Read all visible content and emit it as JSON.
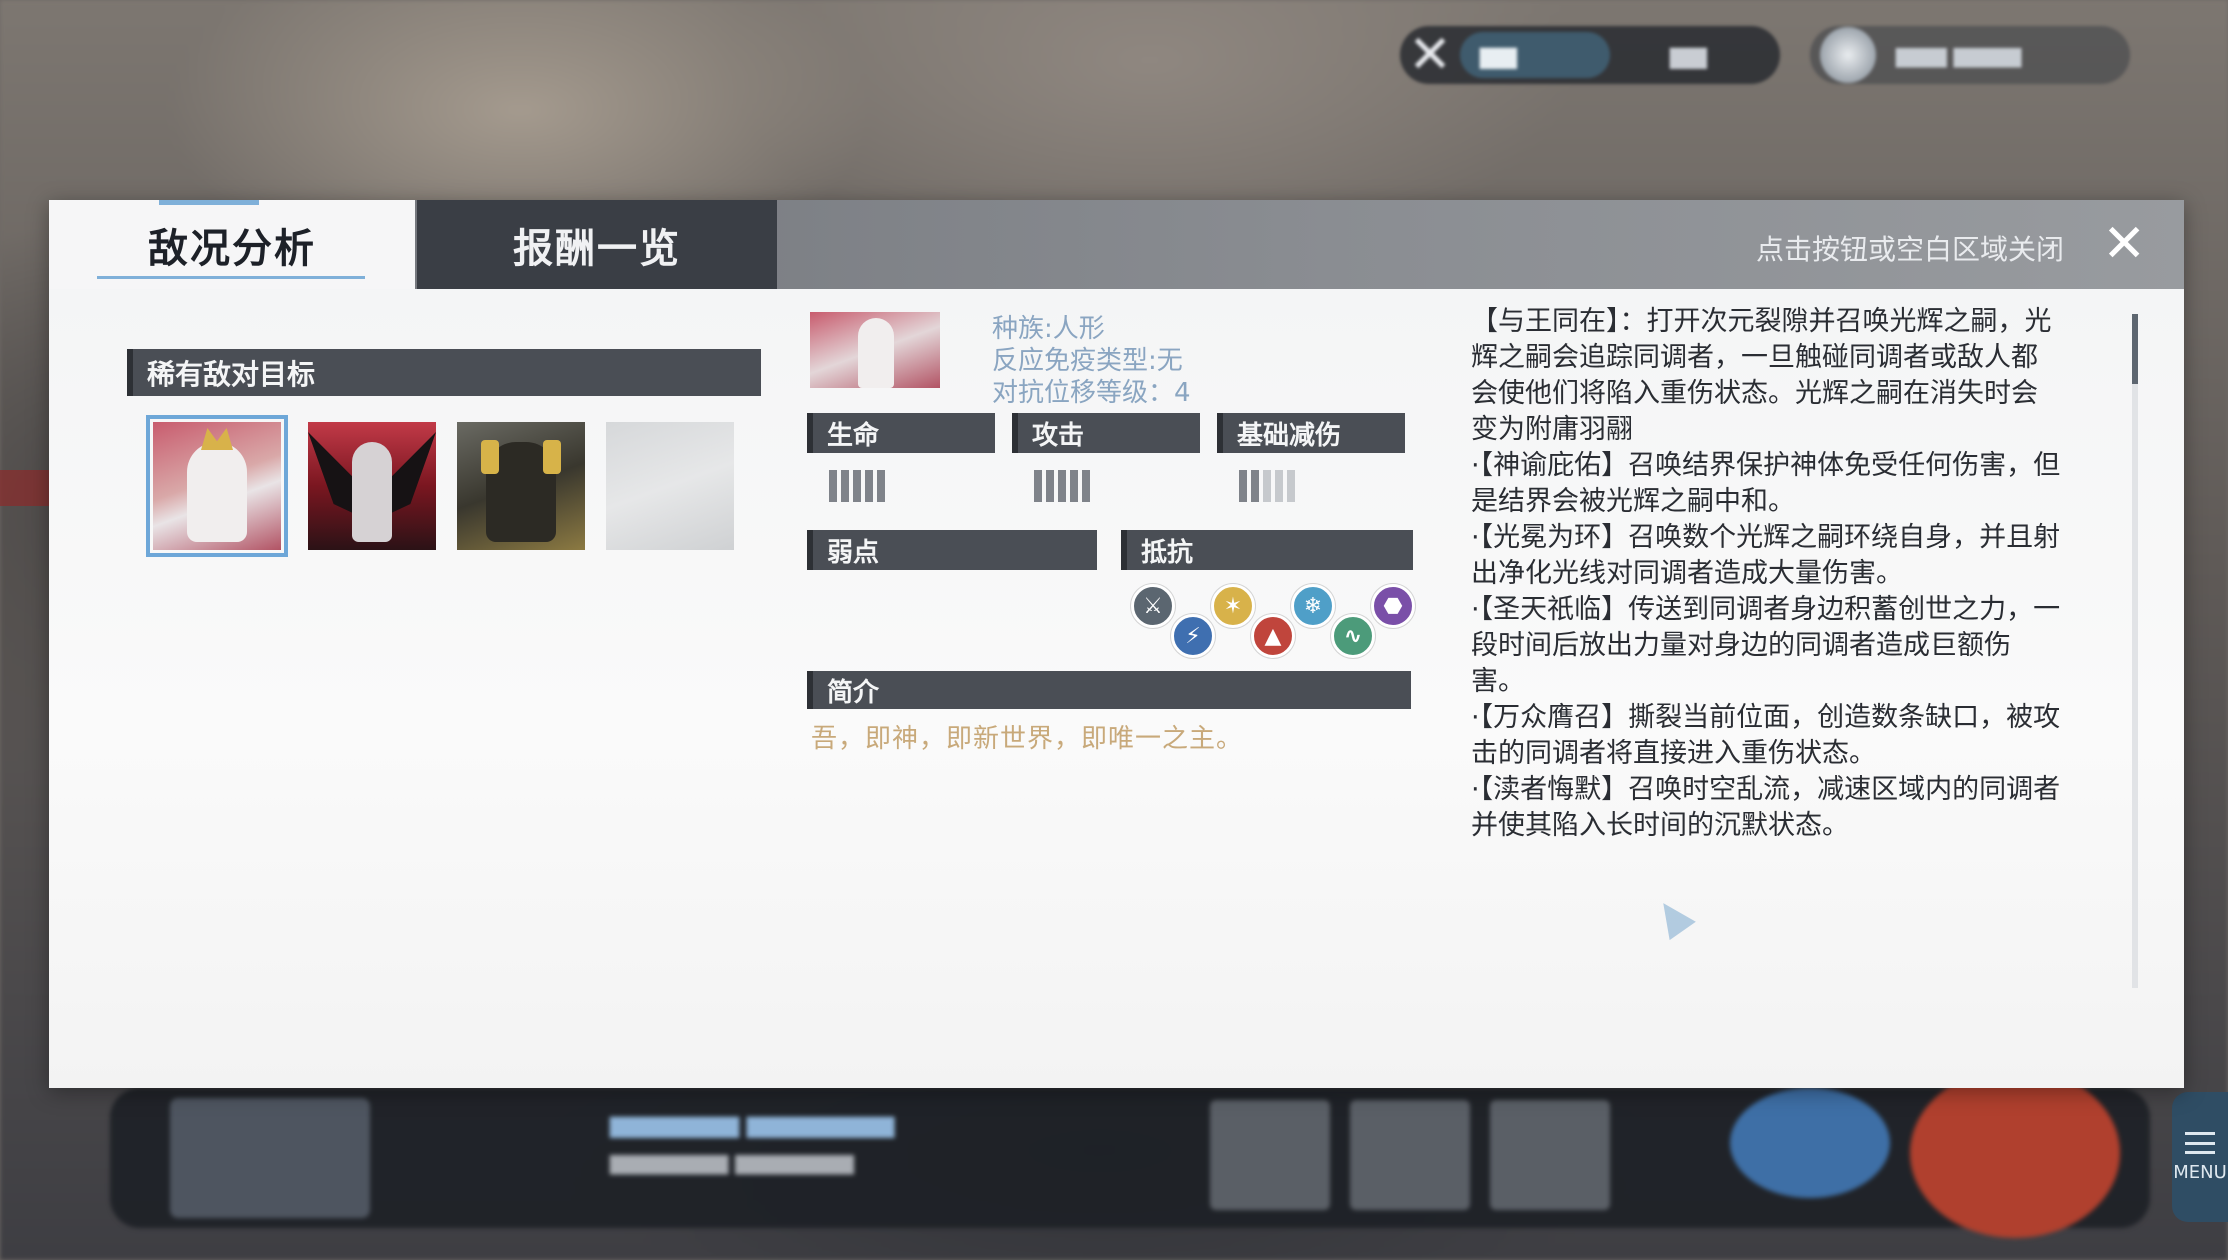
{
  "tabs": [
    {
      "label": "敌况分析",
      "active": true
    },
    {
      "label": "报酬一览",
      "active": false
    }
  ],
  "close_hint": "点击按钮或空白区域关闭",
  "close_icon": "close-icon",
  "rare_targets": {
    "title": "稀有敌对目标",
    "portraits": [
      "enemy-portrait-1",
      "enemy-portrait-2",
      "enemy-portrait-3",
      "enemy-portrait-4"
    ],
    "selected_index": 0
  },
  "enemy_info": {
    "race": "种族:人形",
    "immunity": "反应免疫类型:无",
    "level": "对抗位移等级：4"
  },
  "stats": {
    "hp": {
      "label": "生命",
      "level": 5,
      "max": 5
    },
    "atk": {
      "label": "攻击",
      "level": 5,
      "max": 5
    },
    "def": {
      "label": "基础减伤",
      "level": 2,
      "max": 5
    }
  },
  "weakness": {
    "label": "弱点"
  },
  "resistance": {
    "label": "抵抗",
    "icons": [
      {
        "name": "physical-resist-icon",
        "color": "#5b6670"
      },
      {
        "name": "electric-resist-icon",
        "color": "#3f6fb0"
      },
      {
        "name": "light-resist-icon",
        "color": "#d8b24a"
      },
      {
        "name": "fire-resist-icon",
        "color": "#c0453c"
      },
      {
        "name": "ice-resist-icon",
        "color": "#4f9fc8"
      },
      {
        "name": "wind-resist-icon",
        "color": "#4c9b7a"
      },
      {
        "name": "dark-resist-icon",
        "color": "#7a4fa8"
      }
    ]
  },
  "intro": {
    "label": "简介",
    "text": "吾，即神，即新世界，即唯一之主。"
  },
  "description": [
    "【与王同在】：打开次元裂隙并召唤光辉之嗣，光辉之嗣会追踪同调者，一旦触碰同调者或敌人都会使他们将陷入重伤状态。光辉之嗣在消失时会变为附庸羽翮",
    "·【神谕庇佑】召唤结界保护神体免受任何伤害，但是结界会被光辉之嗣中和。",
    "·【光冕为环】召唤数个光辉之嗣环绕自身，并且射出净化光线对同调者造成大量伤害。",
    "·【圣天祇临】传送到同调者身边积蓄创世之力，一段时间后放出力量对身边的同调者造成巨额伤害。",
    "·【万众膺召】撕裂当前位面，创造数条缺口，被攻击的同调者将直接进入重伤状态。",
    "·【渎者悔默】召唤时空乱流，减速区域内的同调者并使其陷入长时间的沉默状态。"
  ],
  "menu_label": "MENU"
}
